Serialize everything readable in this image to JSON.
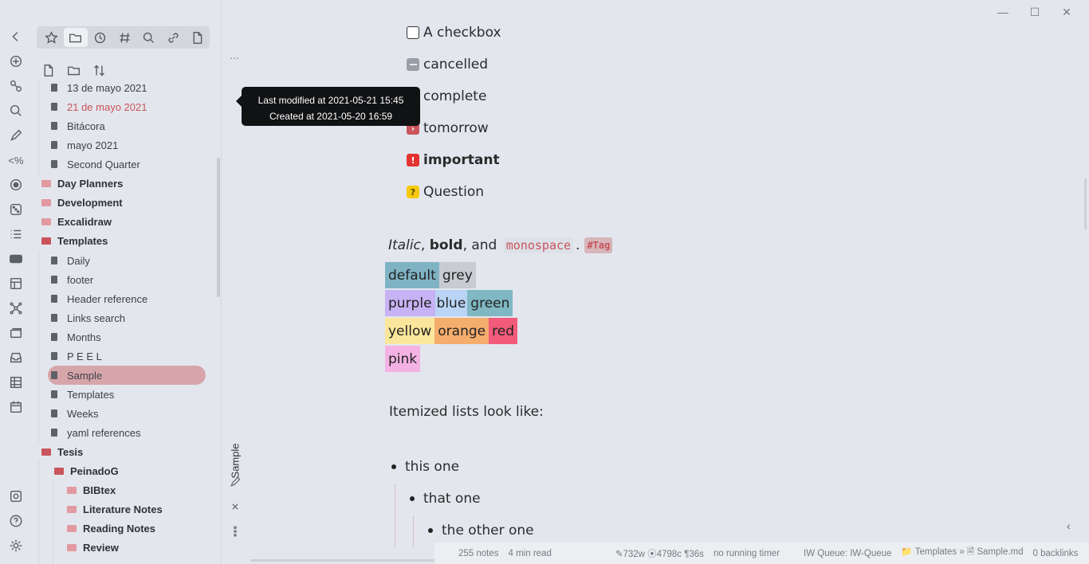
{
  "window": {
    "minimize": "—",
    "maximize": "☐",
    "close": "✕"
  },
  "ribbon": {
    "icons": [
      "collapse-icon",
      "new-note-icon",
      "graph-link-icon",
      "search-icon",
      "pencil-icon",
      "template-icon",
      "record-icon",
      "dice-icon",
      "list-icon",
      "markdown-icon",
      "kanban-icon",
      "graph-icon",
      "cards-icon",
      "inbox-icon",
      "table-icon",
      "calendar-icon",
      "vault-icon",
      "help-icon",
      "settings-icon"
    ],
    "code_label": "<%"
  },
  "sidebar": {
    "tabs": [
      "star-icon",
      "folder-icon",
      "clock-icon",
      "hash-icon",
      "search-icon",
      "link-icon",
      "file-icon"
    ],
    "file_actions": [
      "new-file-icon",
      "new-folder-icon",
      "sort-icon"
    ],
    "items": [
      {
        "label": "13 de mayo 2021",
        "type": "file"
      },
      {
        "label": "21 de mayo 2021",
        "type": "file"
      },
      {
        "label": "Bitácora",
        "type": "file"
      },
      {
        "label": "mayo 2021",
        "type": "file"
      },
      {
        "label": "Second Quarter",
        "type": "file"
      },
      {
        "label": "Day Planners",
        "type": "folder"
      },
      {
        "label": "Development",
        "type": "folder"
      },
      {
        "label": "Excalidraw",
        "type": "folder"
      },
      {
        "label": "Templates",
        "type": "folder-open"
      },
      {
        "label": "Daily",
        "type": "file"
      },
      {
        "label": "footer",
        "type": "file"
      },
      {
        "label": "Header reference",
        "type": "file"
      },
      {
        "label": "Links search",
        "type": "file"
      },
      {
        "label": "Months",
        "type": "file"
      },
      {
        "label": "P E E L",
        "type": "file"
      },
      {
        "label": "Sample",
        "type": "file"
      },
      {
        "label": "Templates",
        "type": "file"
      },
      {
        "label": "Weeks",
        "type": "file"
      },
      {
        "label": "yaml references",
        "type": "file"
      },
      {
        "label": "Tesis",
        "type": "folder-open"
      },
      {
        "label": "PeinadoG",
        "type": "folder-open"
      },
      {
        "label": "BIBtex",
        "type": "folder"
      },
      {
        "label": "Literature Notes",
        "type": "folder"
      },
      {
        "label": "Reading Notes",
        "type": "folder"
      },
      {
        "label": "Review",
        "type": "folder"
      }
    ]
  },
  "tooltip": {
    "modified": "Last modified at 2021-05-21 15:45",
    "created": "Created at 2021-05-20 16:59"
  },
  "tab_strip": {
    "title": "Sample"
  },
  "note": {
    "tasks": [
      {
        "label": "A checkbox",
        "kind": "empty"
      },
      {
        "label": "cancelled",
        "kind": "cancel"
      },
      {
        "label": "complete",
        "kind": "complete"
      },
      {
        "label": "tomorrow",
        "kind": "tom"
      },
      {
        "label": "important",
        "kind": "imp"
      },
      {
        "label": "Question",
        "kind": "q"
      }
    ],
    "formatting": {
      "italic": "Italic",
      "sep1": ",",
      "bold": "bold",
      "sep2": ", and",
      "mono": "monospace",
      "dot": ".",
      "tag": "#Tag"
    },
    "highlights": [
      [
        {
          "text": "default",
          "color": "#7fb3c4"
        },
        {
          "text": "grey",
          "color": "#c8cbd2"
        }
      ],
      [
        {
          "text": "purple",
          "color": "#c6b2f4"
        },
        {
          "text": "blue",
          "color": "#b9d4f5"
        },
        {
          "text": "green",
          "color": "#7fb7c2"
        }
      ],
      [
        {
          "text": "yellow",
          "color": "#fbe79c"
        },
        {
          "text": "orange",
          "color": "#f5ad6e"
        },
        {
          "text": "red",
          "color": "#f25b7a"
        }
      ],
      [
        {
          "text": "pink",
          "color": "#f3b2e3"
        }
      ]
    ],
    "lists_intro": "Itemized lists look like:",
    "list": [
      "this one",
      "that one",
      "the other one"
    ]
  },
  "status": {
    "notes": "255 notes",
    "read": "4 min read",
    "counts": "✎732w ⦿4798c ¶36s",
    "timer": "no running timer",
    "queue": "IW Queue: IW-Queue",
    "path": "📁 Templates » 🗎 Sample.md",
    "backlinks": "0 backlinks"
  }
}
